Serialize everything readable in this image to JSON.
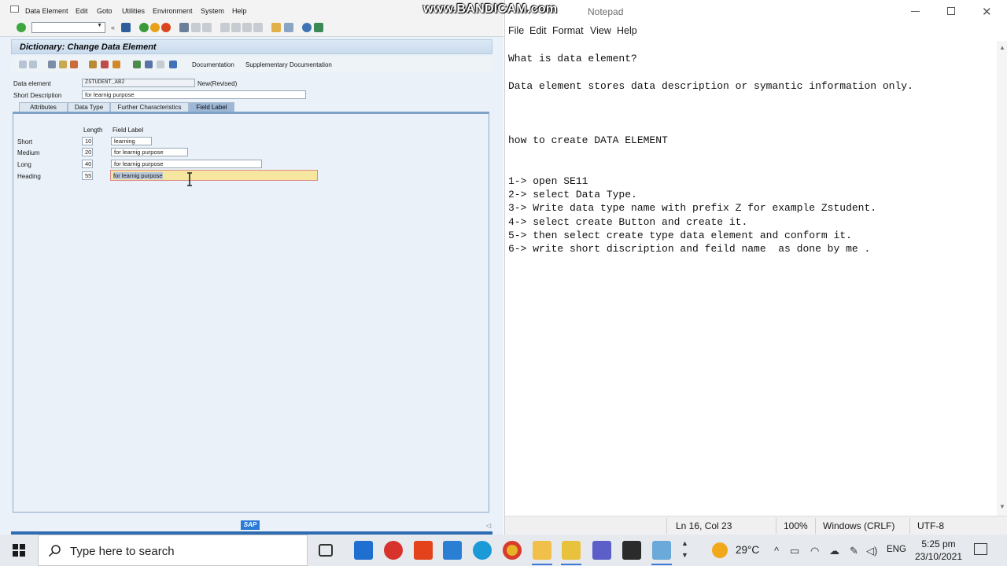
{
  "sap": {
    "menu": [
      "Data Element",
      "Edit",
      "Goto",
      "Utilities",
      "Environment",
      "System",
      "Help"
    ],
    "title": "Dictionary: Change Data Element",
    "app_toolbar": {
      "documentation": "Documentation",
      "supplementary": "Supplementary Documentation"
    },
    "data_element_label": "Data element",
    "data_element_value": "ZSTUDENT_AB2",
    "status": "New(Revised)",
    "short_desc_label": "Short Description",
    "short_desc_value": "for learnig purpose",
    "tabs": [
      "Attributes",
      "Data Type",
      "Further Characteristics",
      "Field Label"
    ],
    "active_tab": "Field Label",
    "field_label_table": {
      "col_length": "Length",
      "col_field_label": "Field Label",
      "rows": [
        {
          "name": "Short",
          "length": "10",
          "label": "learning"
        },
        {
          "name": "Medium",
          "length": "20",
          "label": "for learnig purpose"
        },
        {
          "name": "Long",
          "length": "40",
          "label": "for learnig purpose"
        },
        {
          "name": "Heading",
          "length": "55",
          "label": "for learnig purpose"
        }
      ]
    },
    "logo": "SAP"
  },
  "notepad": {
    "title": "Notepad",
    "watermark": "www.BANDICAM.com",
    "menu": [
      "File",
      "Edit",
      "Format",
      "View",
      "Help"
    ],
    "lines": [
      "What is data element?",
      "",
      "Data element stores data description or symantic information only.",
      "",
      "",
      "",
      "how to create DATA ELEMENT",
      "",
      "",
      "1-> open SE11",
      "2-> select Data Type.",
      "3-> Write data type name with prefix Z for example Zstudent.",
      "4-> select create Button and create it.",
      "5-> then select create type data element and conform it.",
      "6-> write short discription and feild name  as done by me ."
    ],
    "status": {
      "position": "Ln 16, Col 23",
      "zoom": "100%",
      "line_ending": "Windows (CRLF)",
      "encoding": "UTF-8"
    }
  },
  "taskbar": {
    "search_placeholder": "Type here to search",
    "temperature": "29°C",
    "language": "ENG",
    "time": "5:25 pm",
    "date": "23/10/2021"
  }
}
